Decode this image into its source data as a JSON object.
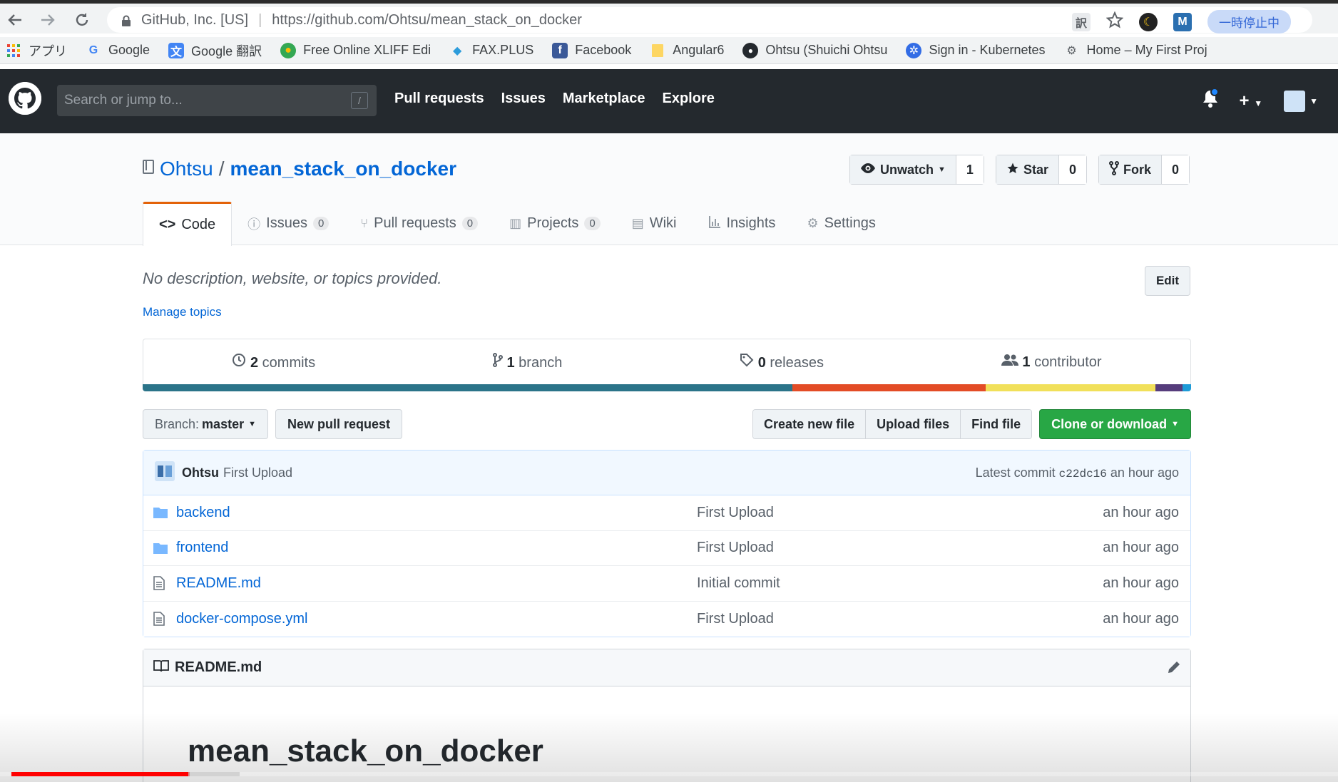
{
  "browser": {
    "site_identity": "GitHub, Inc. [US]",
    "url": "https://github.com/Ohtsu/mean_stack_on_docker",
    "paused_label": "一時停止中",
    "bookmarks": [
      {
        "label": "アプリ",
        "icon": "apps-grid-icon"
      },
      {
        "label": "Google",
        "icon": "google-icon"
      },
      {
        "label": "Google 翻訳",
        "icon": "translate-icon"
      },
      {
        "label": "Free Online XLIFF Edi",
        "icon": "xliff-icon"
      },
      {
        "label": "FAX.PLUS",
        "icon": "fax-icon"
      },
      {
        "label": "Facebook",
        "icon": "facebook-icon"
      },
      {
        "label": "Angular6",
        "icon": "folder-icon"
      },
      {
        "label": "Ohtsu (Shuichi Ohtsu",
        "icon": "github-icon"
      },
      {
        "label": "Sign in - Kubernetes",
        "icon": "kubernetes-icon"
      },
      {
        "label": "Home – My First Proj",
        "icon": "gear-icon"
      }
    ]
  },
  "github": {
    "search_placeholder": "Search or jump to...",
    "search_shortcut": "/",
    "nav": [
      "Pull requests",
      "Issues",
      "Marketplace",
      "Explore"
    ]
  },
  "repo": {
    "owner": "Ohtsu",
    "separator": "/",
    "name": "mean_stack_on_docker",
    "watch_label": "Unwatch",
    "watch_count": "1",
    "star_label": "Star",
    "star_count": "0",
    "fork_label": "Fork",
    "fork_count": "0",
    "tabs": [
      {
        "label": "Code",
        "count": null,
        "active": true
      },
      {
        "label": "Issues",
        "count": "0"
      },
      {
        "label": "Pull requests",
        "count": "0"
      },
      {
        "label": "Projects",
        "count": "0"
      },
      {
        "label": "Wiki",
        "count": null
      },
      {
        "label": "Insights",
        "count": null
      },
      {
        "label": "Settings",
        "count": null
      }
    ],
    "description": "No description, website, or topics provided.",
    "edit_label": "Edit",
    "manage_topics": "Manage topics",
    "summary": {
      "commits_num": "2",
      "commits_label": "commits",
      "branch_num": "1",
      "branch_label": "branch",
      "releases_num": "0",
      "releases_label": "releases",
      "contributor_num": "1",
      "contributor_label": "contributor"
    },
    "languages": [
      {
        "color": "#2b7489",
        "share": 0.62
      },
      {
        "color": "#e34c26",
        "share": 0.184
      },
      {
        "color": "#f1e05a",
        "share": 0.162
      },
      {
        "color": "#563d7c",
        "share": 0.026
      },
      {
        "color": "#1e9bd7",
        "share": 0.008
      }
    ],
    "branch_prefix": "Branch:",
    "branch_name": "master",
    "new_pr_label": "New pull request",
    "create_file_label": "Create new file",
    "upload_label": "Upload files",
    "find_label": "Find file",
    "clone_label": "Clone or download",
    "commit": {
      "author": "Ohtsu",
      "message": "First Upload",
      "latest_label": "Latest commit",
      "sha": "c22dc16",
      "age": "an hour ago"
    },
    "files": [
      {
        "type": "dir",
        "name": "backend",
        "message": "First Upload",
        "age": "an hour ago"
      },
      {
        "type": "dir",
        "name": "frontend",
        "message": "First Upload",
        "age": "an hour ago"
      },
      {
        "type": "file",
        "name": "README.md",
        "message": "Initial commit",
        "age": "an hour ago"
      },
      {
        "type": "file",
        "name": "docker-compose.yml",
        "message": "First Upload",
        "age": "an hour ago"
      }
    ],
    "readme_filename": "README.md",
    "readme_title": "mean_stack_on_docker"
  },
  "video": {
    "played_fraction": 0.133
  }
}
